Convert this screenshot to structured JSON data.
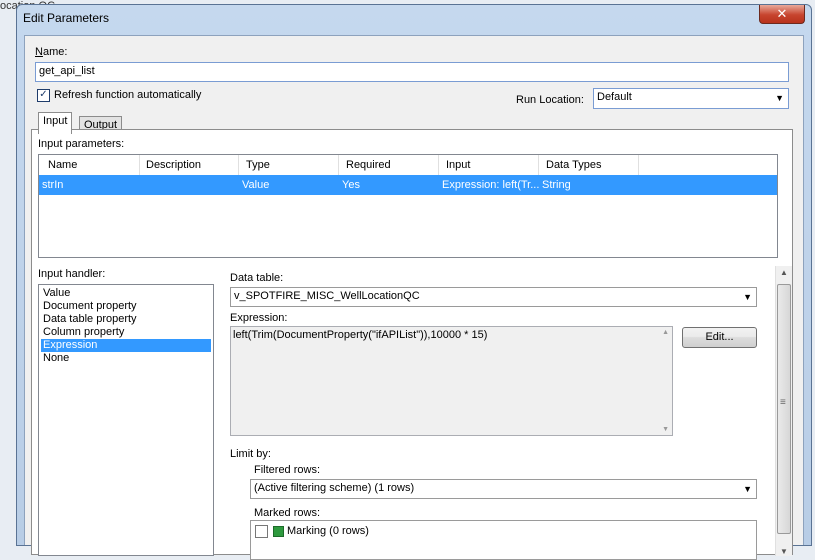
{
  "background_text": "ocation QC",
  "window": {
    "title": "Edit Parameters",
    "close_glyph": "✕"
  },
  "name": {
    "label": "Name:",
    "value": "get_api_list"
  },
  "refresh": {
    "label": "Refresh function automatically",
    "checked": true
  },
  "run_location": {
    "label": "Run Location:",
    "value": "Default"
  },
  "tabs": [
    {
      "label": "Input",
      "active": true
    },
    {
      "label": "Output",
      "active": false
    }
  ],
  "input_parameters": {
    "label": "Input parameters:",
    "columns": [
      "Name",
      "Description",
      "Type",
      "Required",
      "Input",
      "Data Types"
    ],
    "rows": [
      {
        "name": "strIn",
        "description": "",
        "type": "Value",
        "required": "Yes",
        "input": "Expression: left(Tr...",
        "data_types": "String"
      }
    ]
  },
  "input_handler": {
    "label": "Input handler:",
    "items": [
      "Value",
      "Document property",
      "Data table property",
      "Column property",
      "Expression",
      "None"
    ],
    "selected": "Expression"
  },
  "data_table": {
    "label": "Data table:",
    "value": "v_SPOTFIRE_MISC_WellLocationQC"
  },
  "expression": {
    "label": "Expression:",
    "value": "left(Trim(DocumentProperty(\"ifAPIList\")),10000 * 15)",
    "edit_label": "Edit..."
  },
  "limit_by": {
    "label": "Limit by:",
    "filtered_rows_label": "Filtered rows:",
    "filtered_rows_value": "(Active filtering scheme) (1 rows)",
    "marked_rows_label": "Marked rows:",
    "marking_item": "Marking (0 rows)",
    "marking_color": "#2e9a3e"
  },
  "icons": {
    "checkbox_check": "✓",
    "dropdown": "▼",
    "scroll_up": "▲",
    "scroll_down": "▼",
    "grip": "≡"
  }
}
